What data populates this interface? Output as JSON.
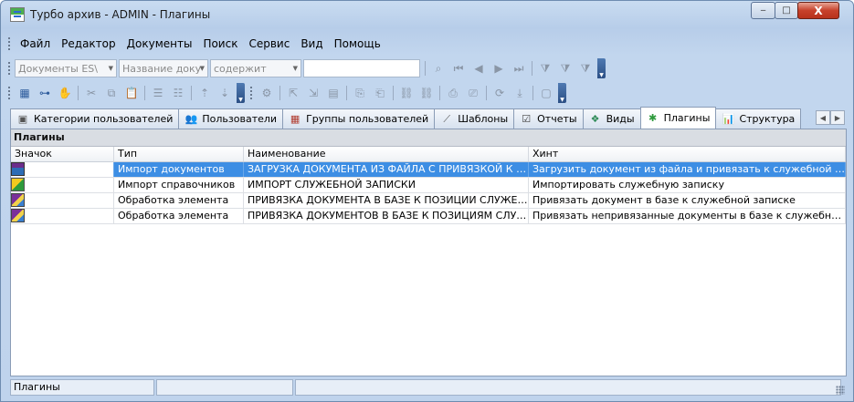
{
  "window": {
    "title": "Турбо архив - ADMIN - Плагины",
    "minimize": "‒",
    "maximize": "□",
    "close": "X"
  },
  "menu": [
    "Файл",
    "Редактор",
    "Документы",
    "Поиск",
    "Сервис",
    "Вид",
    "Помощь"
  ],
  "toolbar1": {
    "combo1": "Документы ES\\",
    "combo2": "Название доку",
    "combo3": "содержит",
    "search_value": ""
  },
  "tabs": [
    {
      "label": "Категории пользователей",
      "icon": "categories-icon"
    },
    {
      "label": "Пользователи",
      "icon": "users-icon"
    },
    {
      "label": "Группы пользователей",
      "icon": "groups-icon"
    },
    {
      "label": "Шаблоны",
      "icon": "templates-icon"
    },
    {
      "label": "Отчеты",
      "icon": "reports-icon"
    },
    {
      "label": "Виды",
      "icon": "types-icon"
    },
    {
      "label": "Плагины",
      "icon": "plugins-icon"
    },
    {
      "label": "Структура",
      "icon": "structure-icon"
    }
  ],
  "active_tab": "Плагины",
  "panel": {
    "title": "Плагины",
    "columns": [
      "Значок",
      "Тип",
      "Наименование",
      "Хинт"
    ],
    "rows": [
      {
        "icon": "plugin-import-icon",
        "type": "Импорт документов",
        "name": "ЗАГРУЗКА ДОКУМЕНТА ИЗ ФАЙЛА С ПРИВЯЗКОЙ К СЛ...",
        "hint": "Загрузить документ из файла и привязать к служебной записке",
        "selected": true
      },
      {
        "icon": "plugin-directory-icon",
        "type": "Импорт справочников",
        "name": "ИМПОРТ СЛУЖЕБНОЙ ЗАПИСКИ",
        "hint": "Импортировать служебную записку",
        "selected": false
      },
      {
        "icon": "plugin-link-icon",
        "type": "Обработка элемента",
        "name": "ПРИВЯЗКА ДОКУМЕНТА В БАЗЕ К ПОЗИЦИИ СЛУЖЕБН...",
        "hint": "Привязать документ в базе к служебной записке",
        "selected": false
      },
      {
        "icon": "plugin-link-icon",
        "type": "Обработка элемента",
        "name": "ПРИВЯЗКА ДОКУМЕНТОВ В БАЗЕ К ПОЗИЦИЯМ СЛУЖЕ...",
        "hint": "Привязать непривязанные документы в базе к служебным зап...",
        "selected": false
      }
    ]
  },
  "status": {
    "text": "Плагины",
    "cell2": "",
    "cell3": ""
  },
  "colors": {
    "selection": "#3d8ee4",
    "chrome": "#bfd3ec"
  }
}
